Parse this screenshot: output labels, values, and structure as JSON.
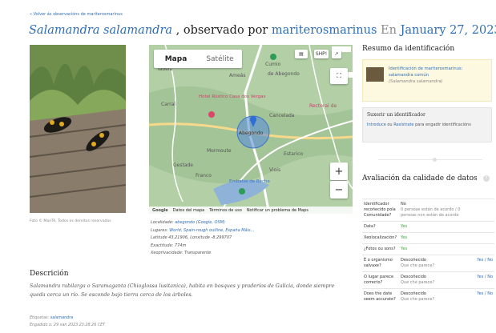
{
  "back_link": "« Volver ás observacións de mariterosmarinus",
  "title": {
    "taxon": "Salamandra salamandra",
    "observed_by": ", observado por",
    "user": "mariterosmarinus",
    "en": "En",
    "date": "January 27, 2023"
  },
  "photo": {
    "credit": "Foto © MariTé, Todos os dereitos reservados"
  },
  "map": {
    "tab_map": "Mapa",
    "tab_satellite": "Satélite",
    "shp_label": "SHP!",
    "footer": [
      "Google",
      "Datos del mapa",
      "Términos de uso",
      "Notificar un problema de Maps"
    ],
    "places": [
      "Ameás",
      "Cumio",
      "Tabeia",
      "Hotel Rústico Casa dos Vergas",
      "Carral",
      "Cancelada",
      "Abegondo",
      "Mormoute",
      "Estarico",
      "Gestade",
      "Franco",
      "Viois",
      "Rectoral de",
      "Embalse de Beche",
      "de Abegondo"
    ],
    "zoom_in": "+",
    "zoom_out": "−"
  },
  "location": {
    "locality_k": "Localidade:",
    "locality_v": "abegondo (Google, OSM)",
    "places_k": "Lugares:",
    "places_v": "World, Spain-rough outline, España Máis...",
    "coords": "Latitude 43.21906, Lonxitude -8.299707",
    "accuracy": "Exactitude: 774m",
    "geoprivacy": "Xeoprivacidade: Transparente"
  },
  "description": {
    "heading": "Descrición",
    "text": "Salamandra rabilarga o Saramaganta (Chioglossa lusitanica), habita en bosques y praderíos de Galicia, donde siempre queda cerca un río. Se esconde bajo tierra cerca de los árboles."
  },
  "tags": {
    "label": "Etiquetas:",
    "value": "salamandra",
    "added": "Engadido o: 29 xan 2023 23:28:26 CET"
  },
  "identification": {
    "heading": "Resumo da identificación",
    "line1": "Identificación de mariterosmarinus:",
    "line2": "salamandra común",
    "scientific": "(Salamandra salamandra)"
  },
  "suggest": {
    "heading": "Suxerir un identificador",
    "intro": "Introduce",
    "or": " ou ",
    "register": "Rexístrate",
    "rest": " para engadir identificacións"
  },
  "quality": {
    "heading": "Avaliación da calidade de datos",
    "help": "?",
    "rows": [
      {
        "q": "Identificador recoñecido pola Comunidade?",
        "a": "No",
        "sub": "0 persoas están de acordo / 0 persoas non están de acordo",
        "yn": ""
      },
      {
        "q": "Data?",
        "a": "Yes",
        "sub": "",
        "yn": ""
      },
      {
        "q": "Xeolocalización?",
        "a": "Yes",
        "sub": "",
        "yn": ""
      },
      {
        "q": "¿Fotos ou sons?",
        "a": "Yes",
        "sub": "",
        "yn": ""
      },
      {
        "q": "É o organismo salvaxe?",
        "a": "Descoñecido",
        "sub": "Que che parece?",
        "yn": "Yes / No"
      },
      {
        "q": "O lugar parece correcto?",
        "a": "Descoñecido",
        "sub": "Que che parece?",
        "yn": "Yes / No"
      },
      {
        "q": "Does the date seem accurate?",
        "a": "Descoñecido",
        "sub": "Que che parece?",
        "yn": "Yes / No"
      }
    ]
  },
  "colors": {
    "link": "#2f6db5",
    "yes": "#3aa63a",
    "id_box": "#fdf9e0"
  }
}
